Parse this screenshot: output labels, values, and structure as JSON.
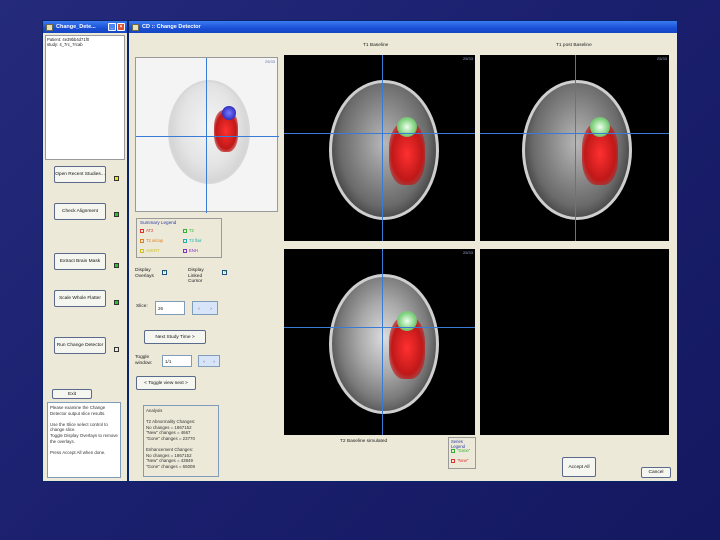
{
  "small_window": {
    "title": "Change_Dete...",
    "info_lines": [
      "Patient: 4e39bb4d71f0",
      "study: 4_7rc_7rcab"
    ]
  },
  "main_window": {
    "title": "CD :: Change Detector"
  },
  "buttons": {
    "open_recent": "Open Recent Studies...",
    "check_alignment": "Check Alignment",
    "extract_brain_mask": "Extract Brain Mask",
    "scale_whole_flatter": "Scale Whole Flatter",
    "run_change_detector": "Run Change Detector",
    "exit": "Exit",
    "next_study": "Next Study Time >",
    "toggle_view": "< Toggle view next >",
    "accept_all": "Accept All",
    "cancel": "Cancel"
  },
  "summary_legend": {
    "title": "Summary Legend",
    "items": [
      {
        "label": "AT2",
        "color": "#e03030"
      },
      {
        "label": "T2",
        "color": "#30b030"
      },
      {
        "label": "T2 w/cap",
        "color": "#e08020"
      },
      {
        "label": "T2 flair",
        "color": "#20b0b0"
      },
      {
        "label": "AVERT",
        "color": "#d0c020"
      },
      {
        "label": "ENH",
        "color": "#8030c0"
      }
    ]
  },
  "controls": {
    "display_overlays_label": "Display Overlays",
    "display_cursor_label": "Display Linked Cursor",
    "slice_label": "Slice:",
    "slice_value": "26",
    "toggle_label": "Toggle window:",
    "toggle_value": "1/1"
  },
  "panels": {
    "t1_baseline": "T1 Baseline",
    "t1_post_baseline": "T1 post Baseline",
    "t2_baseline": "T2 Baseline simulated",
    "counter_overview": "25/33",
    "counter_a": "25/33",
    "counter_b": "25/33",
    "counter_c": "25/33"
  },
  "instructions": "Please examine the Change Detector output slice results.\n\nUse the Slice select control to change slice.\nToggle Display Overlays to remove the overlays.\n\nPress Accept All when done.",
  "analysis": "Analysis\n\nT2 Abnormality Changes:\nNo changes = 1867152\n\"New\" changes = 4667\n\"Gone\" changes = 23770\n\nEnhancement Changes:\nNo changes = 1867152\n\"New\" changes = 43849\n\"Gone\" changes = 65008",
  "series_legend": {
    "title": "Series Legend",
    "items": [
      {
        "label": "\"Gone\"",
        "color": "#30b030"
      },
      {
        "label": "\"New\"",
        "color": "#e03030"
      }
    ]
  },
  "colors": {
    "indicator_yellow": "#f0e020",
    "indicator_green": "#30c030"
  }
}
